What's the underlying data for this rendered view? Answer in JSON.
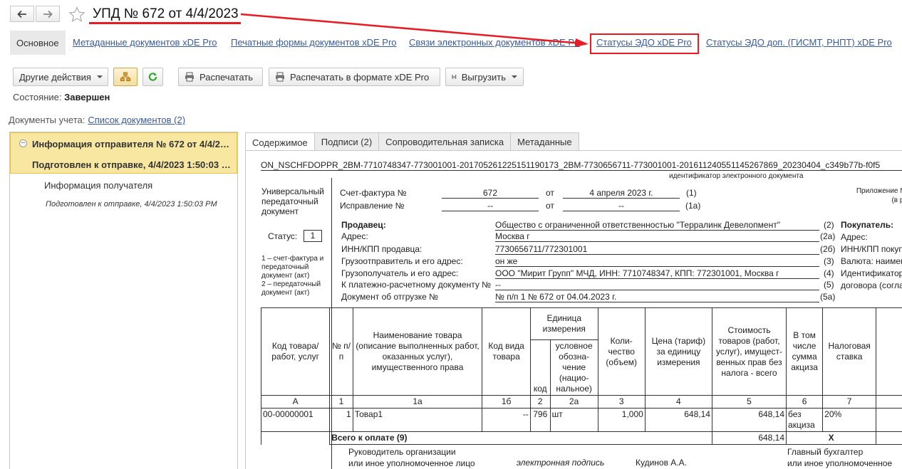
{
  "nav": {
    "back": "back-arrow",
    "forward": "forward-arrow"
  },
  "title": "УПД № 672 от 4/4/2023",
  "top_tabs": {
    "main": "Основное",
    "links": [
      "Метаданные документов xDE Pro",
      "Печатные формы документов xDE Pro",
      "Связи электронных документов xDE Pro",
      "Статусы ЭДО xDE Pro",
      "Статусы ЭДО доп. (ГИСМТ, РНПТ) xDE Pro"
    ]
  },
  "toolbar": {
    "other_actions": "Другие действия",
    "print": "Распечатать",
    "print_xde": "Распечатать в формате xDE Pro",
    "export": "Выгрузить"
  },
  "state": {
    "label": "Состояние:",
    "value": "Завершен"
  },
  "docs": {
    "label": "Документы учета:",
    "link": "Список документов (2)"
  },
  "tree": {
    "selected_line1": "Информация отправителя № 672 от 4/4/2023 1:50:03 PM",
    "selected_line2": "Подготовлен к отправке, 4/4/2023 1:50:03 PM",
    "child_title": "Информация получателя",
    "child_status": "Подготовлен к отправке, 4/4/2023 1:50:03 PM"
  },
  "right_tabs": [
    "Содержимое",
    "Подписи (2)",
    "Сопроводительная записка",
    "Метаданные"
  ],
  "document": {
    "file_id": "ON_NSCHFDOPPR_2BM-7710748347-773001001-201705261225151190173_2BM-7730656711-773001001-20161124055114526786​9_20230404_c349b77b-f0f5",
    "file_id_caption": "идентификатор электронного документа",
    "upd_title": [
      "Универсальный",
      "передаточный",
      "документ"
    ],
    "status_label": "Статус:",
    "status_value": "1",
    "status_note1": [
      "1 – счет-фактура и",
      "передаточный",
      "документ (акт)"
    ],
    "status_note2": [
      "2 – передаточный",
      "документ (акт)"
    ],
    "sf_label": "Счет-фактура №",
    "sf_number": "672",
    "sf_from": "от",
    "sf_date": "4 апреля 2023 г.",
    "sf_code": "(1)",
    "corr_label": "Исправление №",
    "corr_number": "--",
    "corr_from": "от",
    "corr_date": "--",
    "corr_code": "(1а)",
    "appendix": [
      "Приложение №",
      "(в ре"
    ],
    "seller_title": "Продавец:",
    "seller_name": "Общество с ограниченной ответственностью \"Терралинк Девелопмент\"",
    "seller_code": "(2)",
    "addr_label": "Адрес:",
    "addr_value": "Москва г",
    "addr_code": "(2а)",
    "inn_label": "ИНН/КПП продавца:",
    "inn_value": "7730656711/772301001",
    "inn_code": "(2б)",
    "shipper_label": "Грузоотправитель и его адрес:",
    "shipper_value": "он же",
    "shipper_code": "(3)",
    "consignee_label": "Грузополучатель и его адрес:",
    "consignee_value": "ООО \"Мирит Групп\" МЧД, ИНН: 7710748347, КПП: 772301001, Москва г",
    "consignee_code": "(4)",
    "payment_label": "К платежно-расчетному документу №",
    "payment_value": "--",
    "payment_code": "(5)",
    "shipdoc_label": "Документ об отгрузке №",
    "shipdoc_value": "№ п/п 1 № 672 от 04.04.2023 г.",
    "shipdoc_code": "(5а)",
    "buyer_title": "Покупатель:",
    "buyer_lines": [
      "Адрес:",
      "ИНН/КПП покупа",
      "Валюта: наимен",
      "Идентификатор",
      "договора (согла"
    ],
    "headers": {
      "code": "Код товара/ работ, услуг",
      "num": "№ п/п",
      "name": "Наименование товара (описание выполненных работ, оказанных услуг), имущественного права",
      "kind": "Код вида товара",
      "unit": "Единица измерения",
      "unit_code": "код",
      "unit_name": "условное обозна-чение (нацио-нальное)",
      "qty": "Коли-чество (объем)",
      "price": "Цена (тариф) за единицу измерения",
      "cost": "Стоимость товаров (работ, услуг), имущест-венных прав без налога - всего",
      "excise": "В том числе сумма акциза",
      "rate": "Налоговая ставка"
    },
    "col_letters": [
      "А",
      "1",
      "1а",
      "1б",
      "2",
      "2а",
      "3",
      "4",
      "5",
      "6",
      "7"
    ],
    "row": {
      "code": "00-00000001",
      "num": "1",
      "name": "Товар1",
      "kind": "--",
      "unit_code": "796",
      "unit_name": "шт",
      "qty": "1,000",
      "price": "648,14",
      "cost": "648,14",
      "excise": "без акциза",
      "rate": "20%"
    },
    "total_label": "Всего к оплате (9)",
    "total_cost": "648,14",
    "total_mark": "X",
    "footer_left": [
      "Руководитель организации",
      "или иное уполномоченное лицо"
    ],
    "footer_sign": "электронная подпись",
    "footer_name": "Кудинов А.А.",
    "footer_right": [
      "Главный бухгалтер",
      "или иное уполномоченное лицо"
    ]
  },
  "annotation": {
    "color": "#e51c23"
  }
}
